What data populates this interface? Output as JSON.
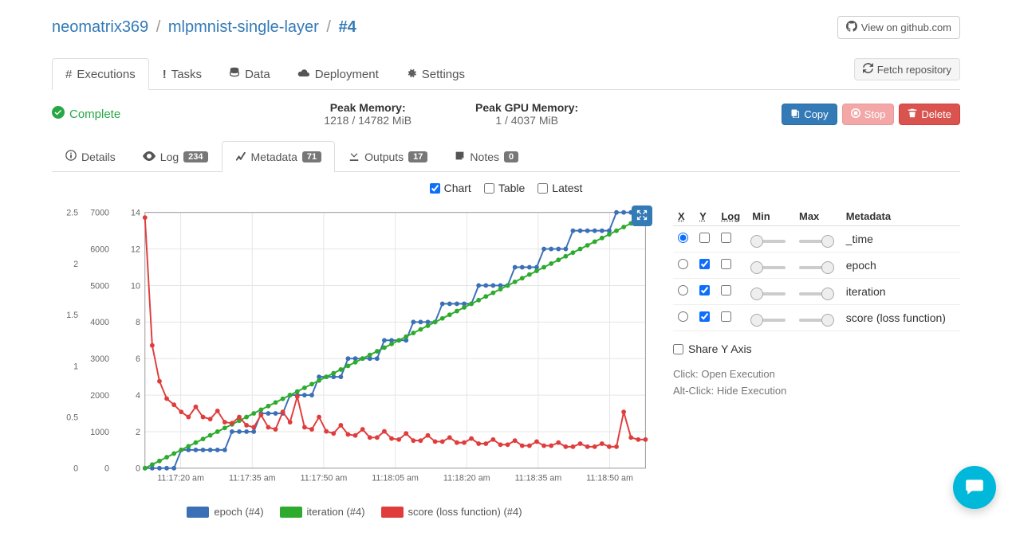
{
  "breadcrumb": {
    "user": "neomatrix369",
    "project": "mlpmnist-single-layer",
    "run": "#4"
  },
  "header_buttons": {
    "github": "View on github.com",
    "fetch": "Fetch repository"
  },
  "main_tabs": {
    "executions": "Executions",
    "tasks": "Tasks",
    "data": "Data",
    "deployment": "Deployment",
    "settings": "Settings"
  },
  "status": {
    "label": "Complete"
  },
  "peak_mem": {
    "label": "Peak Memory:",
    "value": "1218 / 14782 MiB"
  },
  "peak_gpu": {
    "label": "Peak GPU Memory:",
    "value": "1 / 4037 MiB"
  },
  "actions": {
    "copy": "Copy",
    "stop": "Stop",
    "delete": "Delete"
  },
  "sub_tabs": {
    "details": {
      "label": "Details"
    },
    "log": {
      "label": "Log",
      "count": "234"
    },
    "metadata": {
      "label": "Metadata",
      "count": "71"
    },
    "outputs": {
      "label": "Outputs",
      "count": "17"
    },
    "notes": {
      "label": "Notes",
      "count": "0"
    }
  },
  "view_modes": {
    "chart": "Chart",
    "table": "Table",
    "latest": "Latest"
  },
  "side": {
    "headers": {
      "x": "X",
      "y": "Y",
      "log": "Log",
      "min": "Min",
      "max": "Max",
      "metadata": "Metadata"
    },
    "rows": [
      {
        "name": "_time",
        "x": true,
        "y": false,
        "log": false
      },
      {
        "name": "epoch",
        "x": false,
        "y": true,
        "log": false
      },
      {
        "name": "iteration",
        "x": false,
        "y": true,
        "log": false
      },
      {
        "name": "score (loss function)",
        "x": false,
        "y": true,
        "log": false
      }
    ],
    "share_y": "Share Y Axis",
    "hint1": "Click: Open Execution",
    "hint2": "Alt-Click: Hide Execution"
  },
  "legend": [
    {
      "color": "#3b6fb6",
      "label": "epoch (#4)"
    },
    {
      "color": "#2eab2e",
      "label": "iteration (#4)"
    },
    {
      "color": "#e03c3c",
      "label": "score (loss function) (#4)"
    }
  ],
  "chart_data": {
    "type": "line",
    "title": "",
    "xlabel": "",
    "ylabel": "",
    "x_ticks": [
      "11:17:20 am",
      "11:17:35 am",
      "11:17:50 am",
      "11:18:05 am",
      "11:18:20 am",
      "11:18:35 am",
      "11:18:50 am"
    ],
    "y_axes": [
      {
        "name": "score",
        "range": [
          0,
          2.5
        ],
        "ticks": [
          0,
          0.5,
          1.0,
          1.5,
          2.0,
          2.5
        ],
        "color": "#e03c3c"
      },
      {
        "name": "iteration",
        "range": [
          0,
          7000
        ],
        "ticks": [
          0,
          1000,
          2000,
          3000,
          4000,
          5000,
          6000,
          7000
        ],
        "color": "#2eab2e"
      },
      {
        "name": "epoch",
        "range": [
          0,
          14
        ],
        "ticks": [
          0,
          2,
          4,
          6,
          8,
          10,
          12,
          14
        ],
        "color": "#3b6fb6"
      }
    ],
    "x": [
      0,
      1,
      2,
      3,
      4,
      5,
      6,
      7,
      8,
      9,
      10,
      11,
      12,
      13,
      14,
      15,
      16,
      17,
      18,
      19,
      20,
      21,
      22,
      23,
      24,
      25,
      26,
      27,
      28,
      29,
      30,
      31,
      32,
      33,
      34,
      35,
      36,
      37,
      38,
      39,
      40,
      41,
      42,
      43,
      44,
      45,
      46,
      47,
      48,
      49,
      50,
      51,
      52,
      53,
      54,
      55,
      56,
      57,
      58,
      59,
      60,
      61,
      62,
      63,
      64,
      65,
      66,
      67,
      68,
      69
    ],
    "series": [
      {
        "name": "epoch (#4)",
        "axis": "epoch",
        "color": "#3b6fb6",
        "values": [
          0,
          0,
          0,
          0,
          0,
          1,
          1,
          1,
          1,
          1,
          1,
          1,
          2,
          2,
          2,
          2,
          3,
          3,
          3,
          3,
          4,
          4,
          4,
          4,
          5,
          5,
          5,
          5,
          6,
          6,
          6,
          6,
          6,
          7,
          7,
          7,
          7,
          8,
          8,
          8,
          8,
          9,
          9,
          9,
          9,
          9,
          10,
          10,
          10,
          10,
          10,
          11,
          11,
          11,
          11,
          12,
          12,
          12,
          12,
          13,
          13,
          13,
          13,
          13,
          13,
          14,
          14,
          14,
          14,
          14
        ]
      },
      {
        "name": "iteration (#4)",
        "axis": "iteration",
        "color": "#2eab2e",
        "values": [
          0,
          100,
          200,
          300,
          400,
          500,
          600,
          700,
          800,
          900,
          1000,
          1100,
          1200,
          1300,
          1400,
          1500,
          1600,
          1700,
          1800,
          1900,
          2000,
          2100,
          2200,
          2300,
          2400,
          2500,
          2600,
          2700,
          2800,
          2900,
          3000,
          3100,
          3200,
          3300,
          3400,
          3500,
          3600,
          3700,
          3800,
          3900,
          4000,
          4100,
          4200,
          4300,
          4400,
          4500,
          4600,
          4700,
          4800,
          4900,
          5000,
          5100,
          5200,
          5300,
          5400,
          5500,
          5600,
          5700,
          5800,
          5900,
          6000,
          6100,
          6200,
          6300,
          6400,
          6500,
          6600,
          6700,
          6800,
          6900
        ]
      },
      {
        "name": "score (loss function) (#4)",
        "axis": "score",
        "color": "#e03c3c",
        "values": [
          2.45,
          1.2,
          0.85,
          0.68,
          0.62,
          0.55,
          0.5,
          0.6,
          0.5,
          0.48,
          0.56,
          0.45,
          0.44,
          0.5,
          0.42,
          0.4,
          0.52,
          0.4,
          0.38,
          0.55,
          0.45,
          0.7,
          0.4,
          0.38,
          0.5,
          0.36,
          0.34,
          0.42,
          0.33,
          0.32,
          0.38,
          0.3,
          0.3,
          0.36,
          0.29,
          0.28,
          0.34,
          0.27,
          0.27,
          0.32,
          0.26,
          0.26,
          0.3,
          0.25,
          0.25,
          0.29,
          0.24,
          0.24,
          0.28,
          0.23,
          0.23,
          0.27,
          0.22,
          0.22,
          0.26,
          0.22,
          0.22,
          0.25,
          0.21,
          0.21,
          0.24,
          0.21,
          0.21,
          0.24,
          0.21,
          0.21,
          0.55,
          0.3,
          0.28,
          0.28
        ]
      }
    ]
  }
}
